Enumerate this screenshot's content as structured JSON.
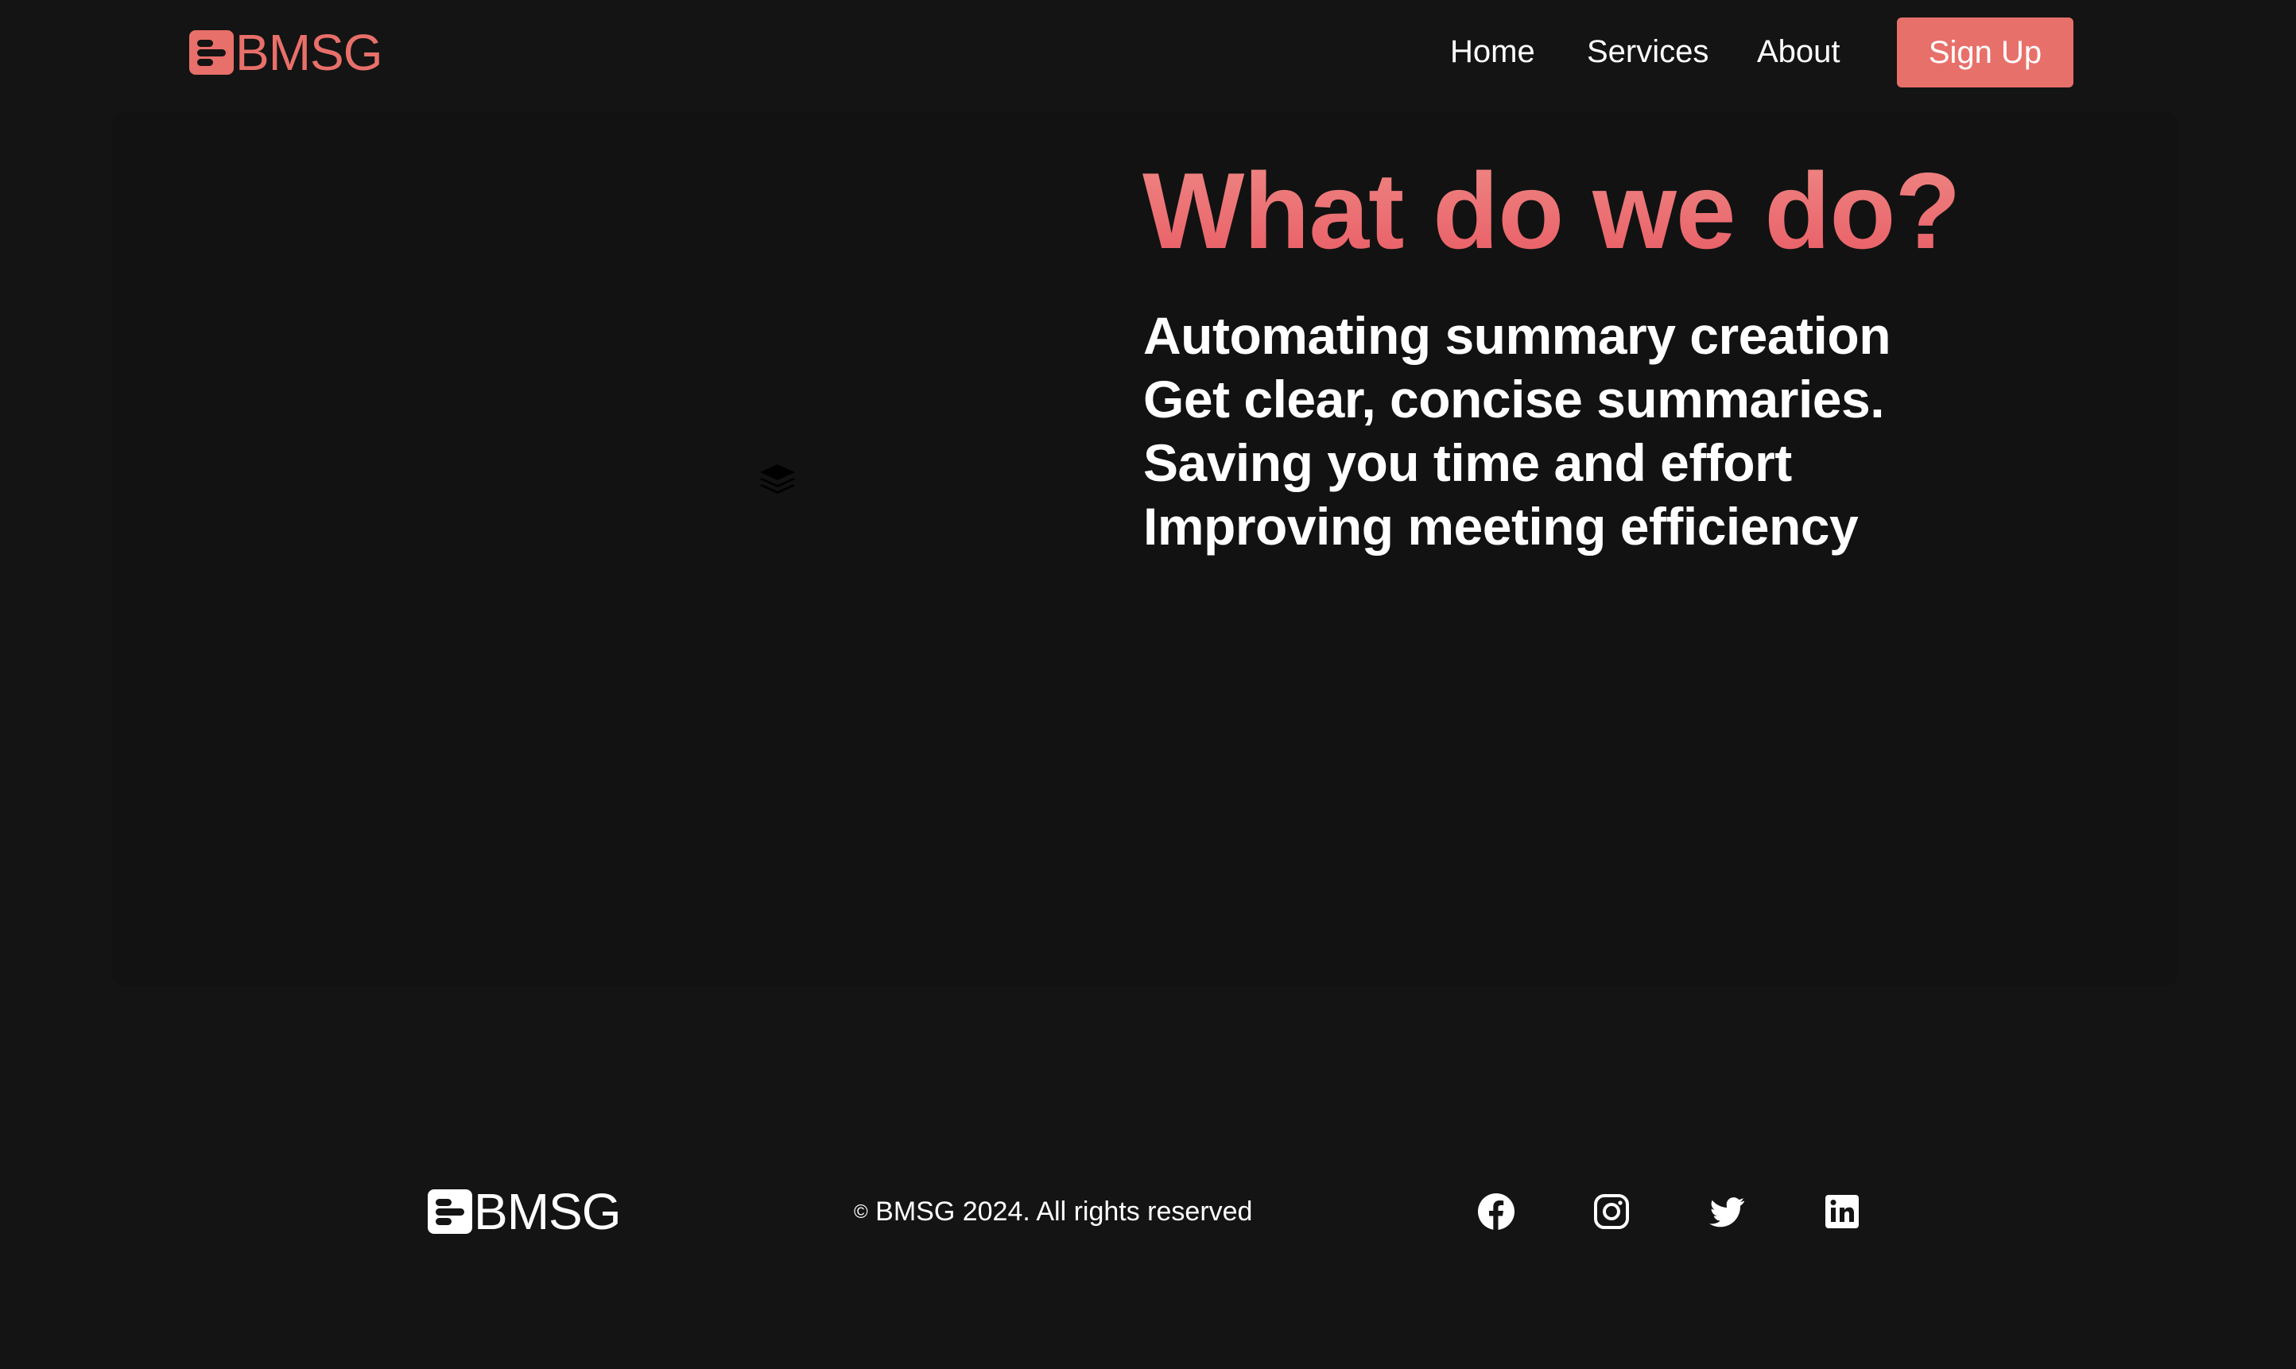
{
  "header": {
    "logo_text": "BMSG",
    "nav": [
      {
        "label": "Home"
      },
      {
        "label": "Services"
      },
      {
        "label": "About"
      }
    ],
    "signup_label": "Sign Up"
  },
  "hero": {
    "title": "What do we do?",
    "features": [
      "Automating summary creation",
      "Get clear, concise summaries.",
      "Saving you time and effort",
      "Improving meeting efficiency"
    ],
    "media_icon": "layers-icon"
  },
  "footer": {
    "logo_text": "BMSG",
    "copyright_symbol": "©",
    "copyright_text": "BMSG 2024. All rights reserved",
    "social_icons": [
      "facebook-icon",
      "instagram-icon",
      "twitter-icon",
      "linkedin-icon"
    ]
  },
  "colors": {
    "background": "#141414",
    "card": "#121212",
    "accent": "#e8706a",
    "title_gradient_top": "#ef8a86",
    "title_gradient_bottom": "#e85a63",
    "text": "#ffffff"
  }
}
